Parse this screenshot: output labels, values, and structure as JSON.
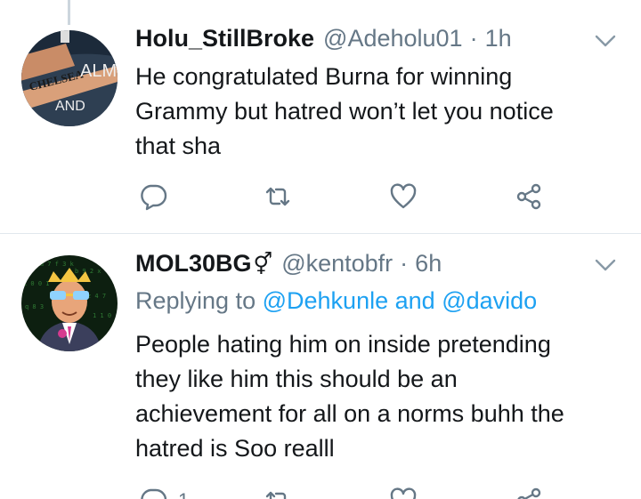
{
  "tweets": [
    {
      "display_name": "Holu_StillBroke",
      "handle": "@Adeholu01",
      "separator": "·",
      "time": "1h",
      "avatar": {
        "icon": "tattoo-avatar-icon",
        "text_lines": [
          "CHELSEA",
          "ALM",
          "AND"
        ]
      },
      "body_lines": [
        "He congratulated Burna for winning",
        "Grammy but hatred won’t let you notice",
        "that sha"
      ],
      "actions": {
        "reply_count": "",
        "retweet_count": "",
        "like_count": ""
      }
    },
    {
      "display_name": "MOL30BG",
      "name_glyph": "⚥",
      "handle": "@kentobfr",
      "separator": "·",
      "time": "6h",
      "avatar": {
        "icon": "cartoon-avatar-icon"
      },
      "replying_prefix": "Replying to",
      "replying_mention_1": "@Dehkunle",
      "replying_and": "and",
      "replying_mention_2": "@davido",
      "body_lines": [
        "People hating him on inside pretending",
        "they like him this should be an",
        "achievement for all on a norms buhh the",
        "hatred is Soo realll"
      ],
      "actions": {
        "reply_count": "1",
        "retweet_count": "",
        "like_count": ""
      }
    }
  ],
  "colors": {
    "text": "#14171a",
    "secondary": "#657786",
    "link": "#1da1f2",
    "divider": "#e1e8ed"
  },
  "icons": [
    "reply-icon",
    "retweet-icon",
    "like-icon",
    "share-icon",
    "chevron-down-icon"
  ]
}
